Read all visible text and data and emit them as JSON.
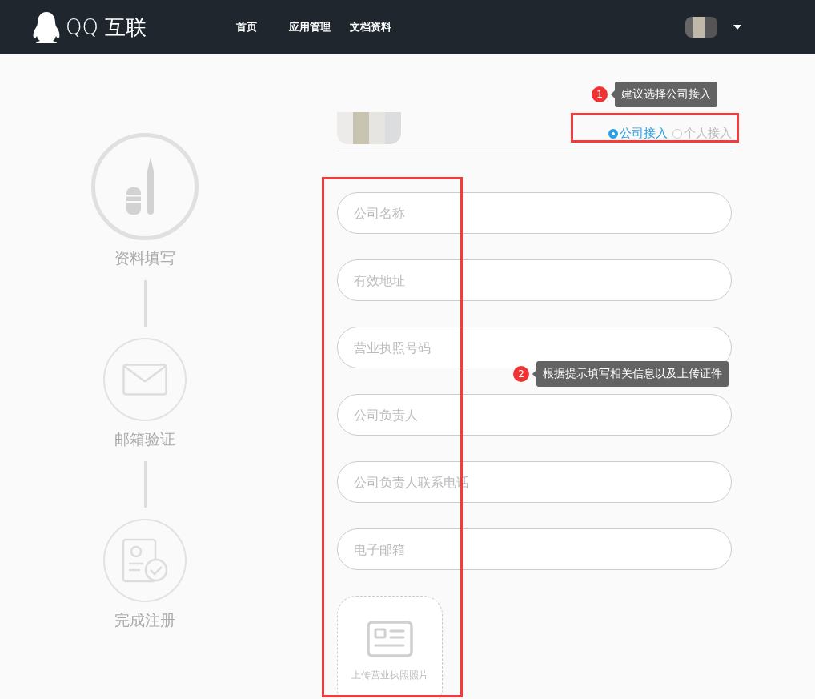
{
  "header": {
    "logo_text": "QQ 互联",
    "nav": [
      {
        "label": "首页"
      },
      {
        "label": "应用管理"
      },
      {
        "label": "文档资料"
      }
    ]
  },
  "steps": [
    {
      "label": "资料填写",
      "kind": "edit",
      "active": true
    },
    {
      "label": "邮箱验证",
      "kind": "mail",
      "active": false
    },
    {
      "label": "完成注册",
      "kind": "done",
      "active": false
    }
  ],
  "access_type": [
    {
      "label": "公司接入",
      "selected": true
    },
    {
      "label": "个人接入",
      "selected": false
    }
  ],
  "fields": [
    {
      "placeholder": "公司名称"
    },
    {
      "placeholder": "有效地址"
    },
    {
      "placeholder": "营业执照号码"
    },
    {
      "placeholder": "公司负责人"
    },
    {
      "placeholder": "公司负责人联系电话"
    },
    {
      "placeholder": "电子邮箱"
    }
  ],
  "upload": {
    "label": "上传营业执照照片"
  },
  "annotations": [
    {
      "number": "1",
      "text": "建议选择公司接入"
    },
    {
      "number": "2",
      "text": "根据提示填写相关信息以及上传证件"
    }
  ]
}
